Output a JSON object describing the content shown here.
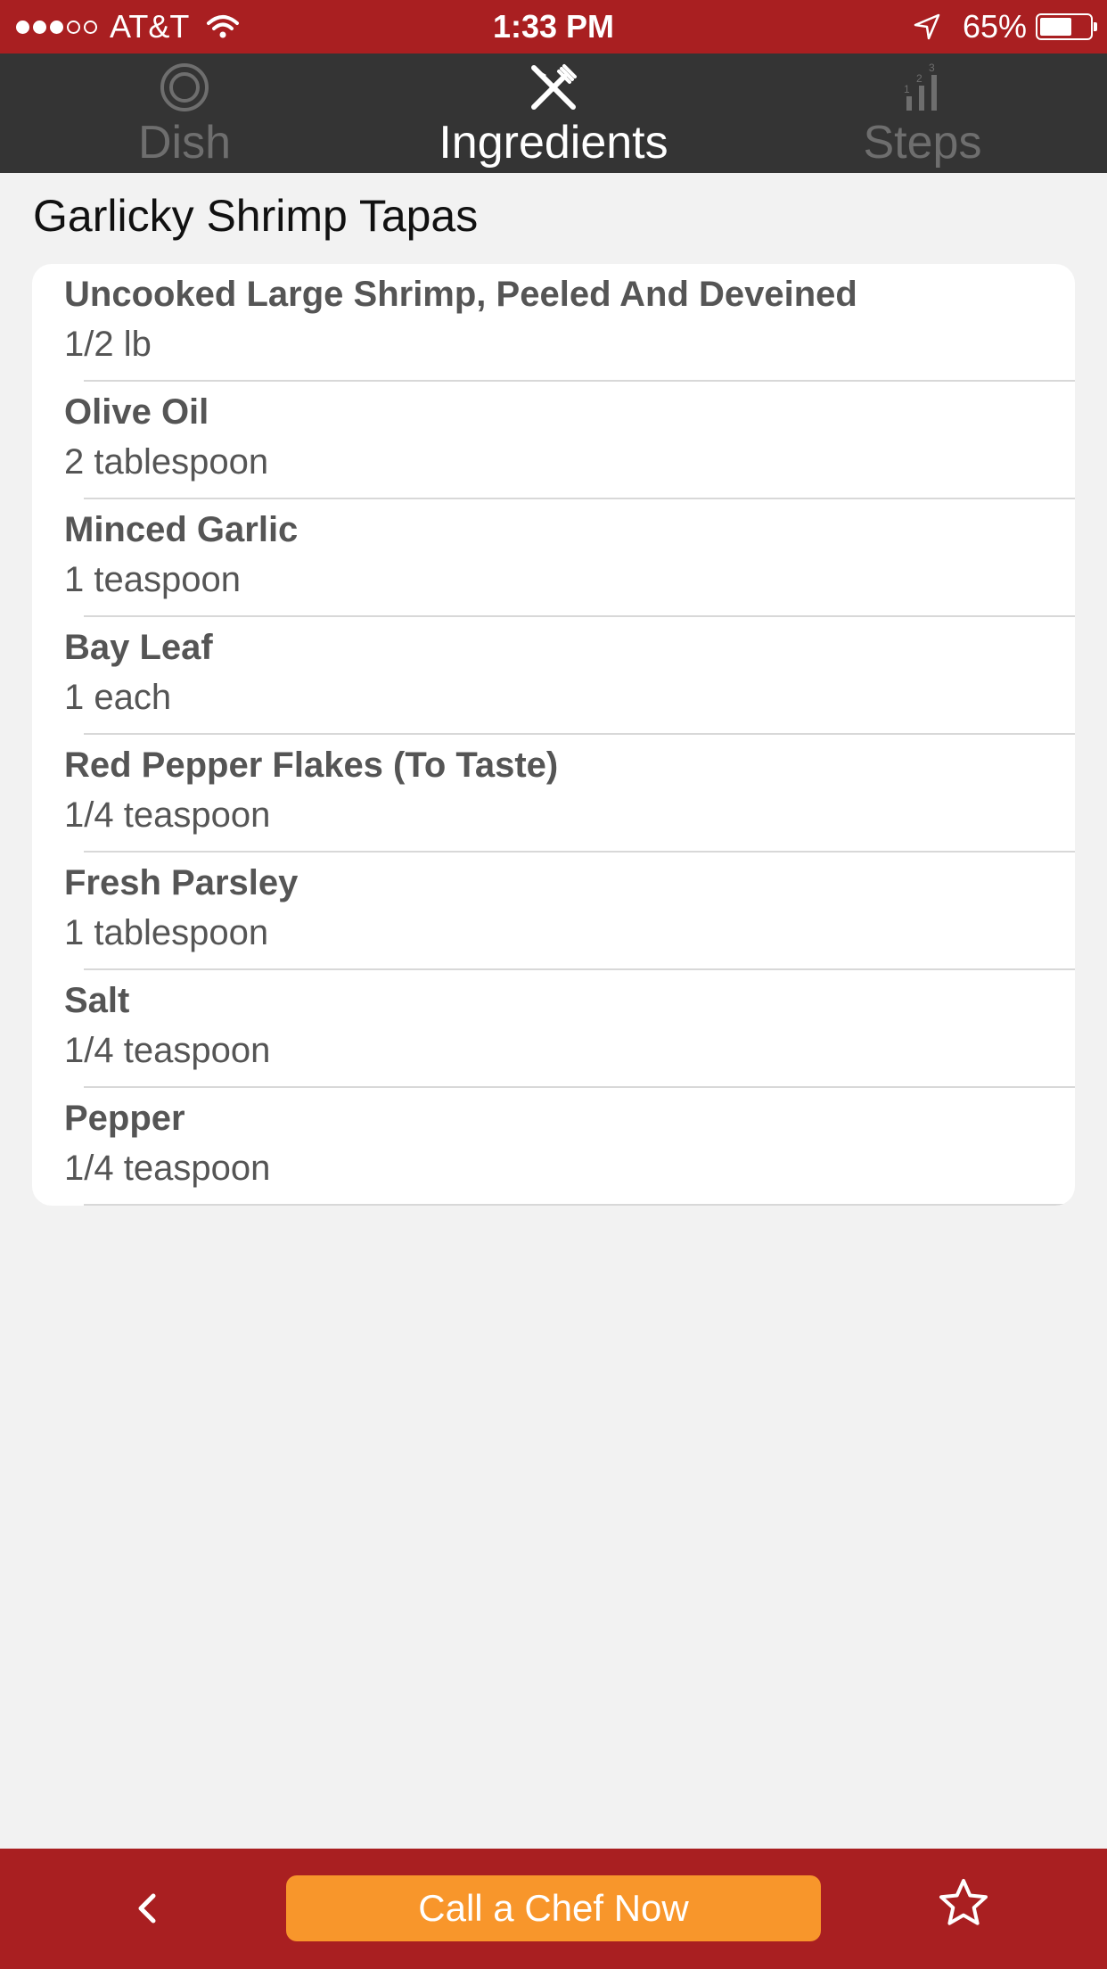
{
  "status_bar": {
    "signal_bars_filled": 3,
    "signal_bars_total": 5,
    "carrier": "AT&T",
    "time": "1:33 PM",
    "battery_percent": "65%",
    "battery_level": 0.65,
    "icons": [
      "wifi-icon",
      "location-arrow-icon",
      "battery-icon"
    ]
  },
  "tabs": [
    {
      "label": "Dish",
      "icon": "plate-icon",
      "active": false
    },
    {
      "label": "Ingredients",
      "icon": "fork-knife-icon",
      "active": true
    },
    {
      "label": "Steps",
      "icon": "numbered-steps-icon",
      "active": false
    }
  ],
  "recipe": {
    "title": "Garlicky Shrimp Tapas"
  },
  "ingredients": [
    {
      "name": "Uncooked Large Shrimp, Peeled And Deveined",
      "amount": "1/2 lb"
    },
    {
      "name": "Olive Oil",
      "amount": "2 tablespoon"
    },
    {
      "name": "Minced Garlic",
      "amount": "1 teaspoon"
    },
    {
      "name": "Bay Leaf",
      "amount": "1 each"
    },
    {
      "name": "Red Pepper Flakes (To Taste)",
      "amount": "1/4 teaspoon"
    },
    {
      "name": "Fresh Parsley",
      "amount": "1 tablespoon"
    },
    {
      "name": "Salt",
      "amount": "1/4 teaspoon"
    },
    {
      "name": "Pepper",
      "amount": "1/4 teaspoon"
    }
  ],
  "bottom_bar": {
    "back_icon": "chevron-left-icon",
    "call_button_label": "Call a Chef Now",
    "favorite_icon": "star-icon"
  },
  "colors": {
    "brand_red": "#a91f21",
    "tab_bar_bg": "#343434",
    "tab_inactive": "#6e6e6e",
    "tab_active": "#ffffff",
    "call_button": "#f8962b",
    "page_bg": "#f2f2f2",
    "ingredient_text": "#555555"
  }
}
